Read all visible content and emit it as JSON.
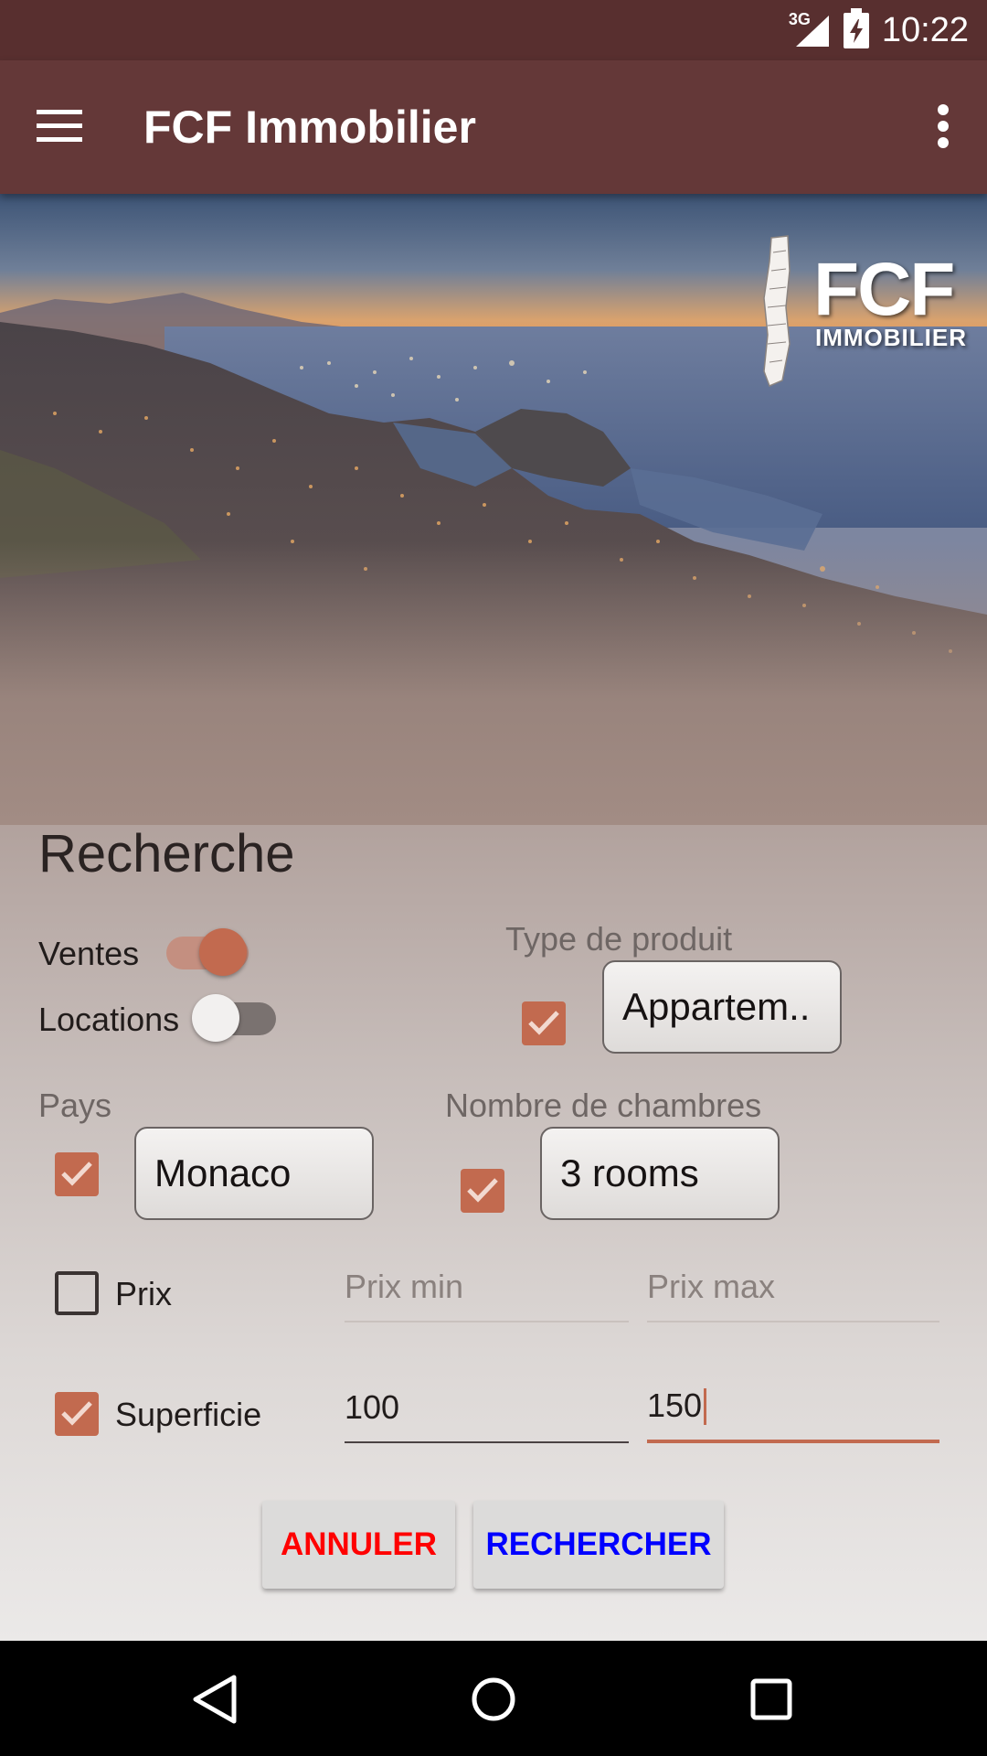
{
  "status_bar": {
    "network": "3G",
    "time": "10:22"
  },
  "app_bar": {
    "title": "FCF Immobilier",
    "menu_icon": "hamburger-menu-icon",
    "more_icon": "more-vert-icon"
  },
  "hero": {
    "logo_main": "FCF",
    "logo_sub": "IMMOBILIER"
  },
  "search": {
    "title": "Recherche",
    "ventes": {
      "label": "Ventes",
      "on": true
    },
    "locations": {
      "label": "Locations",
      "on": false
    },
    "type_produit": {
      "label": "Type de produit",
      "checked": true,
      "value": "Appartem.."
    },
    "pays": {
      "label": "Pays",
      "checked": true,
      "value": "Monaco"
    },
    "chambres": {
      "label": "Nombre de chambres",
      "checked": true,
      "value": "3 rooms"
    },
    "prix": {
      "label": "Prix",
      "checked": false,
      "min_placeholder": "Prix min",
      "max_placeholder": "Prix max"
    },
    "superficie": {
      "label": "Superficie",
      "checked": true,
      "min_value": "100",
      "max_value": "150"
    }
  },
  "actions": {
    "cancel_label": "ANNULER",
    "search_label": "RECHERCHER",
    "cancel_color": "#ff0000",
    "search_color": "#0000ff"
  },
  "colors": {
    "status_bar": "#582f2f",
    "app_bar": "#643838",
    "accent": "#c26a4f"
  }
}
